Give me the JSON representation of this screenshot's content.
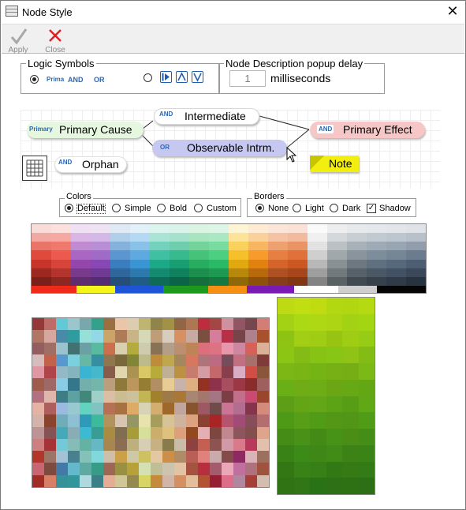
{
  "window": {
    "title": "Node Style",
    "close_glyph": "✕"
  },
  "toolbar": {
    "apply_label": "Apply",
    "close_label": "Close"
  },
  "logic": {
    "title": "Logic Symbols",
    "opt1_primary": "Prima",
    "opt1_and": "AND",
    "opt1_or": "OR",
    "sym_icons": [
      "play-icon",
      "and-caret-icon",
      "or-caret-icon"
    ]
  },
  "delay": {
    "title": "Node Description popup delay",
    "value": "1",
    "unit": "milliseconds"
  },
  "preview": {
    "primary_cause": {
      "tag": "Primary",
      "label": "Primary Cause"
    },
    "intermediate": {
      "tag": "AND",
      "label": "Intermediate"
    },
    "primary_effect": {
      "tag": "AND",
      "label": "Primary Effect"
    },
    "observable": {
      "tag": "OR",
      "label": "Observable Intrm."
    },
    "orphan": {
      "tag": "AND",
      "label": "Orphan"
    },
    "note": {
      "label": "Note"
    }
  },
  "colors": {
    "title": "Colors",
    "options": [
      "Default",
      "Simple",
      "Bold",
      "Custom"
    ],
    "selected": "Default"
  },
  "borders": {
    "title": "Borders",
    "options": [
      "None",
      "Light",
      "Dark"
    ],
    "selected": "None",
    "shadow_label": "Shadow",
    "shadow_checked": true
  },
  "accent_colors": {
    "primary_cause_fill": "#e6f7e0",
    "intermediate_fill": "#ffffff",
    "effect_fill": "#f7c6c6",
    "observable_fill": "#c7c8f2",
    "note_fill": "#f2ee10",
    "logic_blue": "#2e67b0"
  },
  "palette1_columns": [
    [
      "#f8dcd8",
      "#f1aaa3",
      "#e97467",
      "#df4a3d",
      "#c6342a",
      "#9d2820",
      "#79201a"
    ],
    [
      "#fbe0dd",
      "#f6a9a2",
      "#f0796e",
      "#ec5a4f",
      "#d8433a",
      "#b3342d",
      "#8c2821"
    ],
    [
      "#efe1f3",
      "#d9b6e3",
      "#c18bd2",
      "#aa66c3",
      "#9446ad",
      "#793a8d",
      "#5f2e70"
    ],
    [
      "#eee3f5",
      "#d4b8e6",
      "#b98ed6",
      "#a06ac7",
      "#8748b5",
      "#6e3a94",
      "#552c73"
    ],
    [
      "#dfeaf6",
      "#b2cfea",
      "#84b2dd",
      "#5b96d0",
      "#3a7ebf",
      "#2f669c",
      "#254f79"
    ],
    [
      "#e2f0fa",
      "#b5d9f2",
      "#89c2e9",
      "#5eaae0",
      "#3a95d4",
      "#2c79ae",
      "#215c86"
    ],
    [
      "#dcf4ee",
      "#a9e4d5",
      "#72d2bb",
      "#40c0a2",
      "#1ca98a",
      "#148a70",
      "#0f6a56"
    ],
    [
      "#d9f2ea",
      "#a5e1cc",
      "#6dcdad",
      "#39b98e",
      "#179f73",
      "#10815d",
      "#0c6448"
    ],
    [
      "#daf3e3",
      "#a8e4bf",
      "#73d39a",
      "#46c27a",
      "#27ad5f",
      "#1c8e4d",
      "#156e3b"
    ],
    [
      "#dcf5e6",
      "#aae8c3",
      "#78dca0",
      "#4ccf80",
      "#2ab965",
      "#1e9952",
      "#177740"
    ],
    [
      "#fdf4d5",
      "#fbe39a",
      "#f9d15c",
      "#f6c02b",
      "#e2a80f",
      "#b8880c",
      "#8e6909"
    ],
    [
      "#fdebd3",
      "#fbd19b",
      "#f9b660",
      "#f79c2c",
      "#e2820e",
      "#b8690b",
      "#8e5109"
    ],
    [
      "#fbe5d8",
      "#f5c2a4",
      "#eea06f",
      "#e67f42",
      "#d4642a",
      "#ad5022",
      "#863e1a"
    ],
    [
      "#fae3d6",
      "#f2bb9e",
      "#ea9466",
      "#e0713a",
      "#cd5720",
      "#a7461a",
      "#813614"
    ],
    [
      "#fafafa",
      "#f0f0f0",
      "#e2e2e2",
      "#cfcfcf",
      "#b8b8b8",
      "#9e9e9e",
      "#838383"
    ],
    [
      "#eceeef",
      "#d4d8da",
      "#bac0c3",
      "#a1a8ac",
      "#899195",
      "#71797d",
      "#5a6164"
    ],
    [
      "#e7eaec",
      "#c8ced2",
      "#a8b1b7",
      "#89949c",
      "#6d7981",
      "#566169",
      "#414a51"
    ],
    [
      "#e4e8ec",
      "#c1c9d1",
      "#9eabb6",
      "#7d8d9b",
      "#5f7081",
      "#4a5866",
      "#36414c"
    ],
    [
      "#e2e6eb",
      "#bdc5cf",
      "#98a5b3",
      "#758697",
      "#56687c",
      "#425163",
      "#2f3b49"
    ],
    [
      "#dfe3e8",
      "#b8c0ca",
      "#919dac",
      "#6c7c8f",
      "#4d5e73",
      "#3a485a",
      "#283341"
    ]
  ],
  "palette1_strip": [
    [
      "#f02a1a",
      57
    ],
    [
      "#f5f51a",
      49
    ],
    [
      "#1e54d8",
      62
    ],
    [
      "#1d9a1d",
      57
    ],
    [
      "#f78f12",
      49
    ],
    [
      "#7a1ab5",
      60
    ],
    [
      "#ffffff",
      57
    ],
    [
      "#cfcfcf",
      49
    ],
    [
      "#050505",
      62
    ]
  ]
}
